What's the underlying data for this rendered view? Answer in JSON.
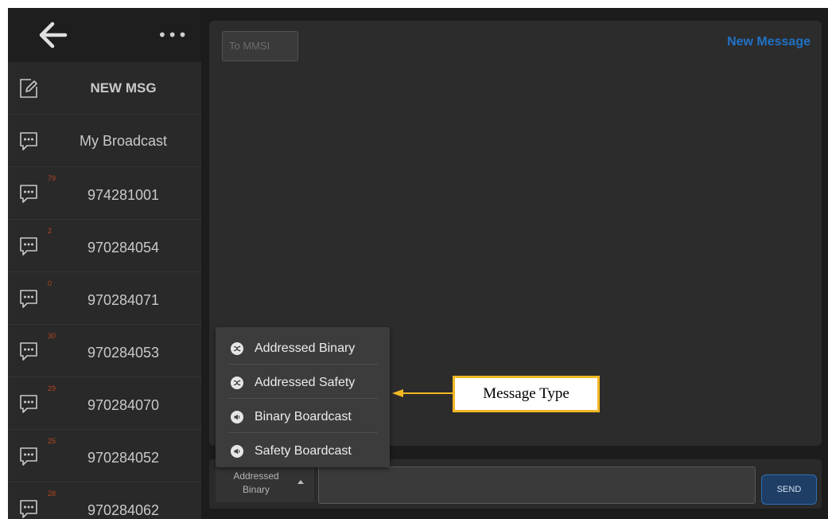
{
  "sidebar": {
    "more_label": "•••",
    "items": [
      {
        "label": "NEW MSG",
        "badge": "",
        "icon": "edit-icon"
      },
      {
        "label": "My Broadcast",
        "badge": "",
        "icon": "chat-bubble-icon"
      },
      {
        "label": "974281001",
        "badge": "79",
        "icon": "chat-bubble-icon"
      },
      {
        "label": "970284054",
        "badge": "2",
        "icon": "chat-bubble-icon"
      },
      {
        "label": "970284071",
        "badge": "0",
        "icon": "chat-bubble-icon"
      },
      {
        "label": "970284053",
        "badge": "30",
        "icon": "chat-bubble-icon"
      },
      {
        "label": "970284070",
        "badge": "29",
        "icon": "chat-bubble-icon"
      },
      {
        "label": "970284052",
        "badge": "25",
        "icon": "chat-bubble-icon"
      },
      {
        "label": "970284062",
        "badge": "28",
        "icon": "chat-bubble-icon"
      }
    ]
  },
  "panel": {
    "to_placeholder": "To MMSI",
    "title": "New Message"
  },
  "bottombar": {
    "type_line1": "Addressed",
    "type_line2": "Binary",
    "send_label": "SEND"
  },
  "dropdown": {
    "options": [
      {
        "label": "Addressed Binary",
        "icon": "shuffle-icon"
      },
      {
        "label": "Addressed Safety",
        "icon": "shuffle-icon"
      },
      {
        "label": "Binary Boardcast",
        "icon": "speaker-icon"
      },
      {
        "label": "Safety Boardcast",
        "icon": "speaker-icon"
      }
    ]
  },
  "callout": {
    "label": "Message Type"
  },
  "colors": {
    "accent_blue": "#2071c6",
    "badge_red": "#b8451f",
    "callout_yellow": "#f2b823"
  }
}
